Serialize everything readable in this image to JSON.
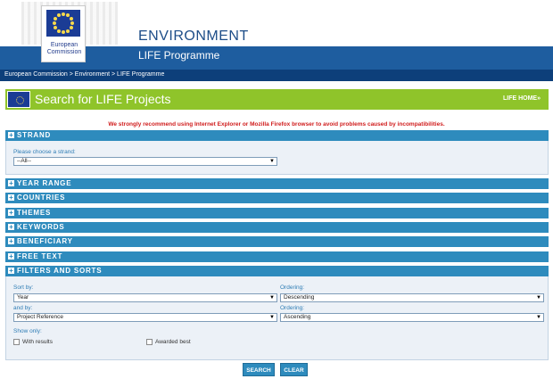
{
  "header": {
    "logo_text_line1": "European",
    "logo_text_line2": "Commission",
    "site_title": "ENVIRONMENT",
    "programme_title": "LIFE Programme",
    "breadcrumb": "European Commission > Environment > LIFE Programme"
  },
  "title_bar": {
    "title": "Search for LIFE Projects",
    "home_link": "LIFE HOME»"
  },
  "warning": "We strongly recommend using Internet Explorer or Mozilla Firefox browser to avoid problems caused by incompatibilities.",
  "sections": {
    "strand": "STRAND",
    "year_range": "YEAR RANGE",
    "countries": "COUNTRIES",
    "themes": "THEMES",
    "keywords": "KEYWORDS",
    "beneficiary": "BENEFICIARY",
    "free_text": "FREE TEXT",
    "filters_sorts": "FILTERS AND SORTS"
  },
  "strand_panel": {
    "label": "Please choose a strand:",
    "value": "--All--"
  },
  "filters": {
    "sort_by_label": "Sort by:",
    "sort_by_value": "Year",
    "ordering1_label": "Ordering:",
    "ordering1_value": "Descending",
    "and_by_label": "and by:",
    "and_by_value": "Project Reference",
    "ordering2_label": "Ordering:",
    "ordering2_value": "Ascending",
    "show_only_label": "Show only:",
    "with_results": "With results",
    "awarded_best": "Awarded best"
  },
  "buttons": {
    "search": "SEARCH",
    "clear": "CLEAR"
  },
  "colors": {
    "accent_blue": "#2e8bbd",
    "header_blue": "#1e5d9f",
    "green_bar": "#8fc42a",
    "warning_red": "#d01c1c"
  }
}
